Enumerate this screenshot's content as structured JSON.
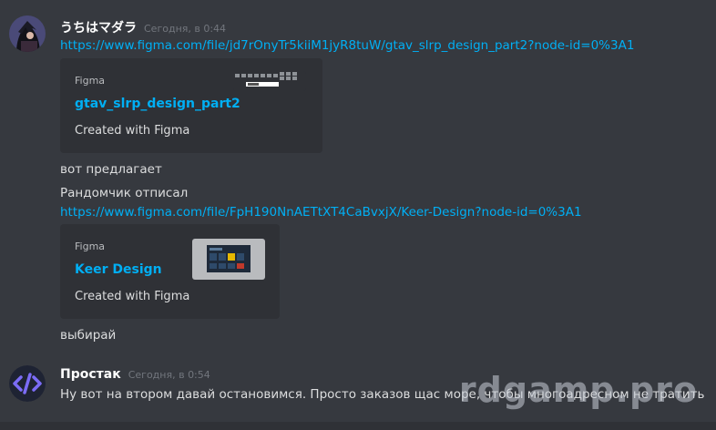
{
  "messages": [
    {
      "author": "うちはマダラ",
      "timestamp": "Сегодня, в 0:44",
      "link1": "https://www.figma.com/file/jd7rOnyTr5kiiM1jyR8tuW/gtav_slrp_design_part2?node-id=0%3A1",
      "embed1": {
        "provider": "Figma",
        "title": "gtav_slrp_design_part2",
        "description": "Created with Figma"
      },
      "text1": "вот предлагает",
      "text2": "Рандомчик отписал",
      "link2": "https://www.figma.com/file/FpH190NnAETtXT4CaBvxjX/Keer-Design?node-id=0%3A1",
      "embed2": {
        "provider": "Figma",
        "title": "Keer Design",
        "description": "Created with Figma"
      },
      "text3": "выбирай"
    },
    {
      "author": "Простак",
      "timestamp": "Сегодня, в 0:54",
      "text1": "Ну вот на втором давай остановимся. Просто заказов щас море, чтобы многоадресном не тратить"
    }
  ],
  "watermark": "rdgamp.pro",
  "colors": {
    "background": "#36393f",
    "embed_bg": "#2f3136",
    "link": "#00aff4",
    "text": "#dcddde",
    "timestamp": "#72767d"
  }
}
